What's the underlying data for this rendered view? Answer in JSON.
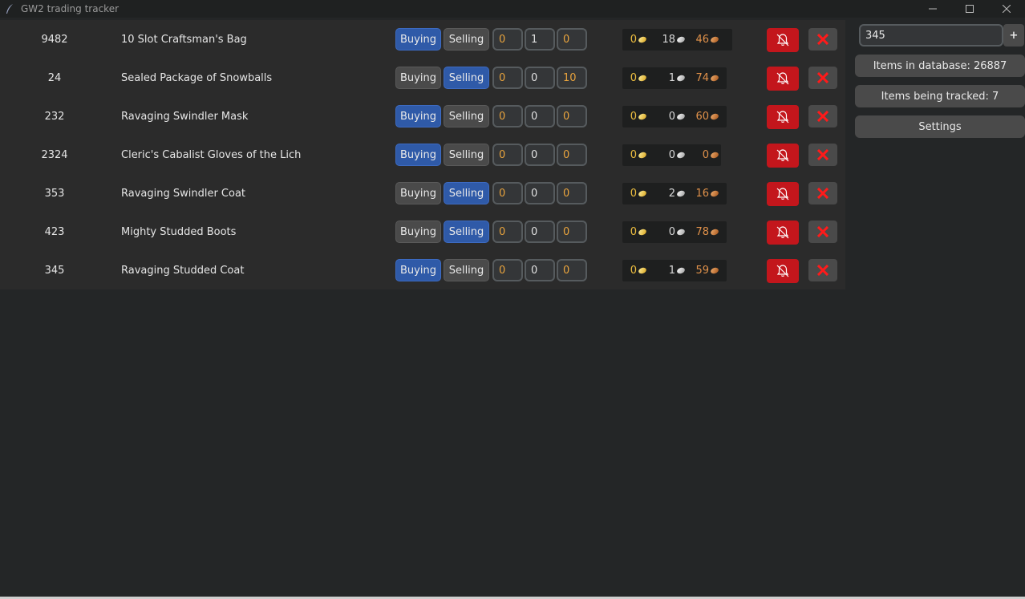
{
  "window": {
    "title": "GW2 trading tracker"
  },
  "sidebar": {
    "item_id_input_value": "345",
    "add_button_label": "+",
    "items_in_database": "Items in database: 26887",
    "items_being_tracked": "Items being tracked: 7",
    "settings_label": "Settings"
  },
  "labels": {
    "buying": "Buying",
    "selling": "Selling"
  },
  "colors": {
    "active_blue": "#2f5aa8",
    "notify_red": "#c3161c",
    "remove_x_red": "#ff1a1a"
  },
  "items": [
    {
      "id": "9482",
      "name": "10 Slot Craftsman's Bag",
      "mode": "buying",
      "target": {
        "gold": "0",
        "silver": "1",
        "copper": "0"
      },
      "price": {
        "gold": "0",
        "silver": "18",
        "copper": "46"
      }
    },
    {
      "id": "24",
      "name": "Sealed Package of Snowballs",
      "mode": "selling",
      "target": {
        "gold": "0",
        "silver": "0",
        "copper": "10"
      },
      "price": {
        "gold": "0",
        "silver": "1",
        "copper": "74"
      }
    },
    {
      "id": "232",
      "name": "Ravaging Swindler Mask",
      "mode": "buying",
      "target": {
        "gold": "0",
        "silver": "0",
        "copper": "0"
      },
      "price": {
        "gold": "0",
        "silver": "0",
        "copper": "60"
      }
    },
    {
      "id": "2324",
      "name": "Cleric's Cabalist Gloves of the Lich",
      "mode": "buying",
      "target": {
        "gold": "0",
        "silver": "0",
        "copper": "0"
      },
      "price": {
        "gold": "0",
        "silver": "0",
        "copper": "0"
      }
    },
    {
      "id": "353",
      "name": "Ravaging Swindler Coat",
      "mode": "selling",
      "target": {
        "gold": "0",
        "silver": "0",
        "copper": "0"
      },
      "price": {
        "gold": "0",
        "silver": "2",
        "copper": "16"
      }
    },
    {
      "id": "423",
      "name": "Mighty Studded Boots",
      "mode": "selling",
      "target": {
        "gold": "0",
        "silver": "0",
        "copper": "0"
      },
      "price": {
        "gold": "0",
        "silver": "0",
        "copper": "78"
      }
    },
    {
      "id": "345",
      "name": "Ravaging Studded Coat",
      "mode": "buying",
      "target": {
        "gold": "0",
        "silver": "0",
        "copper": "0"
      },
      "price": {
        "gold": "0",
        "silver": "1",
        "copper": "59"
      }
    }
  ]
}
